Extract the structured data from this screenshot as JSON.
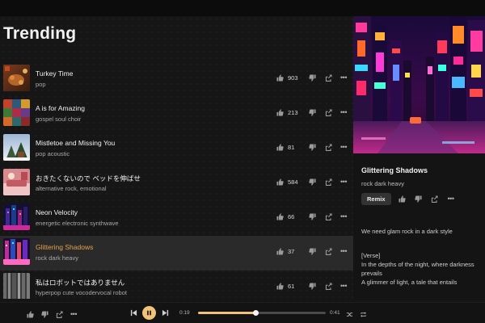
{
  "page": {
    "title": "Trending"
  },
  "songs": [
    {
      "title": "Turkey Time",
      "genre": "pop",
      "likes": "903"
    },
    {
      "title": "A is for Amazing",
      "genre": "gospel soul choir",
      "likes": "213"
    },
    {
      "title": "Mistletoe and Missing You",
      "genre": "pop acoustic",
      "likes": "81"
    },
    {
      "title": "おきたくないので ベッドを伸ばせ",
      "genre": "alternative rock, emotional",
      "likes": "584"
    },
    {
      "title": "Neon Velocity",
      "genre": "energetic electronic synthwave",
      "likes": "66"
    },
    {
      "title": "Glittering Shadows",
      "genre": "rock dark heavy",
      "likes": "37",
      "active": true
    },
    {
      "title": "私はロボットではありません",
      "genre": "hyperpop cute vocodervocal robot",
      "likes": "61"
    }
  ],
  "now_playing": {
    "title": "Glittering Shadows",
    "genre": "rock dark heavy",
    "remix_label": "Remix",
    "description": "We need glam rock in a dark style",
    "lyrics_tag": "[Verse]",
    "lyrics_line1": "In the depths of the night, where darkness prevails",
    "lyrics_line2": "A glimmer of light, a tale that entails"
  },
  "player": {
    "current_time": "0:19",
    "duration": "0:41",
    "progress": 0.45
  },
  "colors": {
    "accent": "#e8a14a",
    "play_button": "#f0c27a",
    "background": "#151515"
  },
  "icons": {
    "like": "thumbs-up-icon",
    "dislike": "thumbs-down-icon",
    "share": "share-icon",
    "more": "more-icon",
    "previous": "skip-previous-icon",
    "pause": "pause-icon",
    "next": "skip-next-icon",
    "shuffle": "shuffle-icon",
    "repeat": "repeat-icon"
  }
}
